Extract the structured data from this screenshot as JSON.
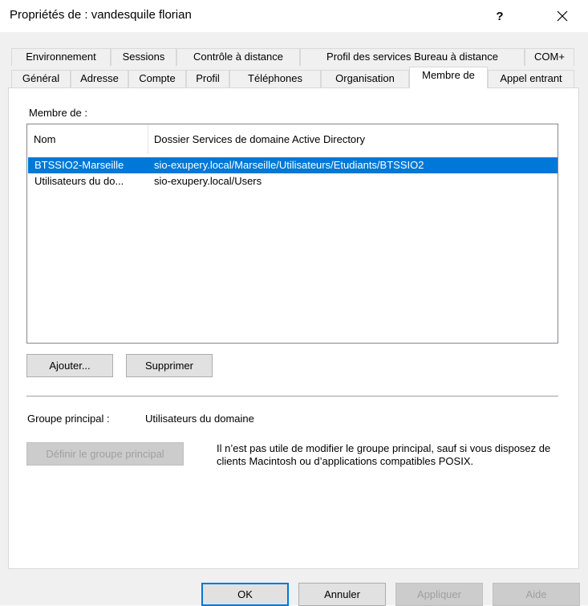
{
  "window": {
    "title": "Propriétés de : vandesquile florian",
    "help_label": "?"
  },
  "tabs_row1": [
    {
      "label": "Environnement"
    },
    {
      "label": "Sessions"
    },
    {
      "label": "Contrôle à distance"
    },
    {
      "label": "Profil des services Bureau à distance"
    },
    {
      "label": "COM+"
    }
  ],
  "tabs_row2": [
    {
      "label": "Général"
    },
    {
      "label": "Adresse"
    },
    {
      "label": "Compte"
    },
    {
      "label": "Profil"
    },
    {
      "label": "Téléphones"
    },
    {
      "label": "Organisation"
    },
    {
      "label": "Membre de",
      "active": true
    },
    {
      "label": "Appel entrant"
    }
  ],
  "member_of": {
    "label": "Membre de :",
    "columns": [
      "Nom",
      "Dossier Services de domaine Active Directory"
    ],
    "rows": [
      {
        "name": "BTSSIO2-Marseille",
        "folder": "sio-exupery.local/Marseille/Utilisateurs/Etudiants/BTSSIO2",
        "selected": true
      },
      {
        "name": "Utilisateurs du do...",
        "folder": "sio-exupery.local/Users",
        "selected": false
      }
    ],
    "add_label": "Ajouter...",
    "remove_label": "Supprimer"
  },
  "primary_group": {
    "label": "Groupe principal :",
    "value": "Utilisateurs du domaine",
    "set_label": "Définir le groupe principal",
    "info": "Il n’est pas utile de modifier le groupe principal, sauf si vous disposez de clients Macintosh ou d’applications compatibles POSIX."
  },
  "footer": {
    "ok_label": "OK",
    "cancel_label": "Annuler",
    "apply_label": "Appliquer",
    "help_label": "Aide"
  },
  "colors": {
    "selection": "#0078d7",
    "dialog_bg": "#f0f0f0",
    "disabled_text": "#a0a0a0"
  }
}
